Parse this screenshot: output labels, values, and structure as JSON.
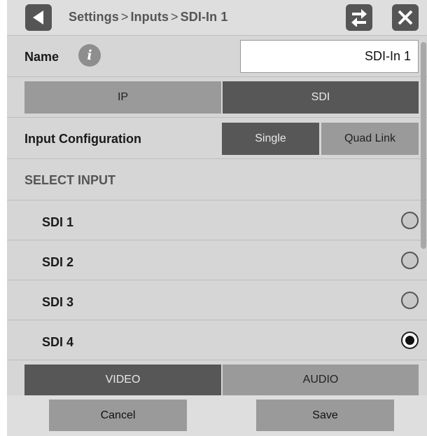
{
  "header": {
    "breadcrumb": [
      "Settings",
      "Inputs",
      "SDI-In 1"
    ],
    "separator": ">"
  },
  "icons": {
    "back": "back-arrow-icon",
    "swap": "swap-arrows-icon",
    "close": "close-x-icon",
    "info": "info-icon"
  },
  "name_field": {
    "label": "Name",
    "info_glyph": "i",
    "value": "SDI-In 1"
  },
  "transport_tabs": [
    {
      "label": "IP",
      "selected": false
    },
    {
      "label": "SDI",
      "selected": true
    }
  ],
  "input_configuration": {
    "label": "Input Configuration",
    "options": [
      {
        "label": "Single",
        "selected": true
      },
      {
        "label": "Quad Link",
        "selected": false
      }
    ]
  },
  "select_input": {
    "heading": "SELECT INPUT",
    "items": [
      {
        "label": "SDI 1",
        "selected": false
      },
      {
        "label": "SDI 2",
        "selected": false
      },
      {
        "label": "SDI 3",
        "selected": false
      },
      {
        "label": "SDI 4",
        "selected": true
      }
    ]
  },
  "media_tabs": [
    {
      "label": "VIDEO",
      "selected": true
    },
    {
      "label": "AUDIO",
      "selected": false
    }
  ],
  "footer": {
    "cancel_label": "Cancel",
    "save_label": "Save"
  },
  "colors": {
    "panel": "#d6d6d6",
    "selected": "#575757",
    "unselected": "#9a9a9a",
    "icon_button": "#555555"
  }
}
